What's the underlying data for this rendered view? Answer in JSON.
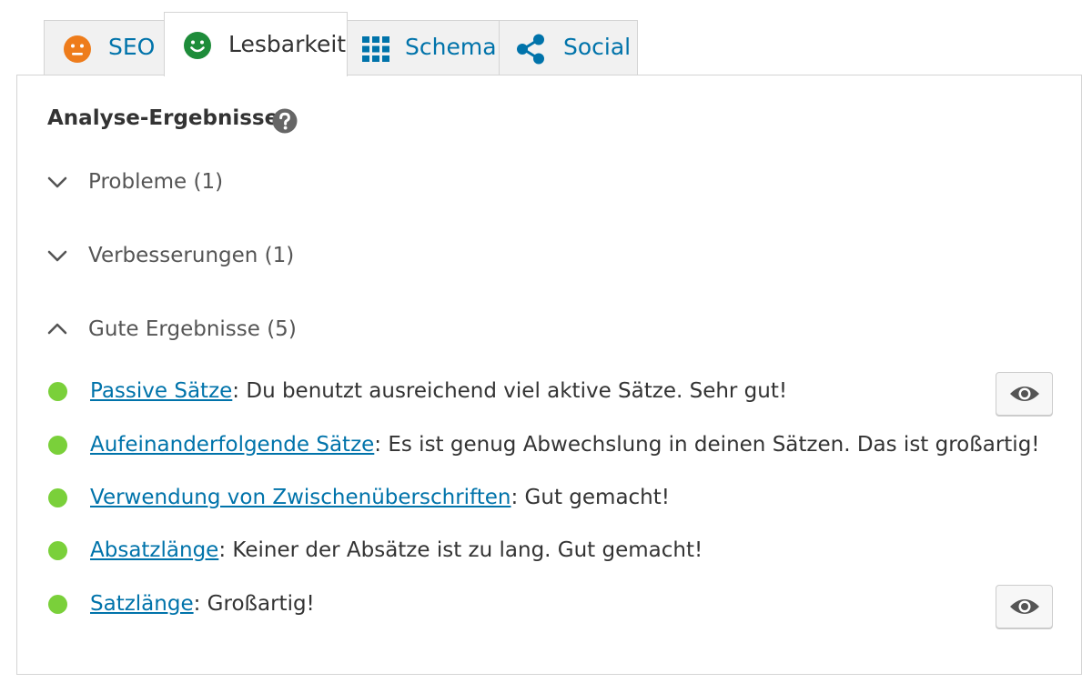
{
  "tabs": [
    {
      "label": "SEO",
      "icon": "face-neutral-icon",
      "color": "#ee7c1b"
    },
    {
      "label": "Lesbarkeit",
      "icon": "face-smile-icon",
      "color": "#1e8c3a",
      "active": true
    },
    {
      "label": "Schema",
      "icon": "grid-icon"
    },
    {
      "label": "Social",
      "icon": "share-icon"
    }
  ],
  "panel": {
    "heading": "Analyse-Ergebnisse"
  },
  "groups": {
    "problems": "Probleme (1)",
    "improvements": "Verbesserungen (1)",
    "good": "Gute Ergebnisse (5)"
  },
  "results": [
    {
      "link": "Passive Sätze",
      "text": ": Du benutzt ausreichend viel aktive Sätze. Sehr gut!"
    },
    {
      "link": "Aufeinanderfolgende Sätze",
      "text": ": Es ist genug Abwechslung in deinen Sätzen. Das ist großartig!"
    },
    {
      "link": "Verwendung von Zwischenüberschriften",
      "text": ": Gut gemacht!"
    },
    {
      "link": "Absatzlänge",
      "text": ": Keiner der Absätze ist zu lang. Gut gemacht!"
    },
    {
      "link": "Satzlänge",
      "text": ": Großartig!"
    }
  ],
  "colors": {
    "link": "#0073aa",
    "good_bullet": "#7ad03a",
    "seo_face": "#ee7c1b",
    "readability_face": "#1e8c3a"
  }
}
